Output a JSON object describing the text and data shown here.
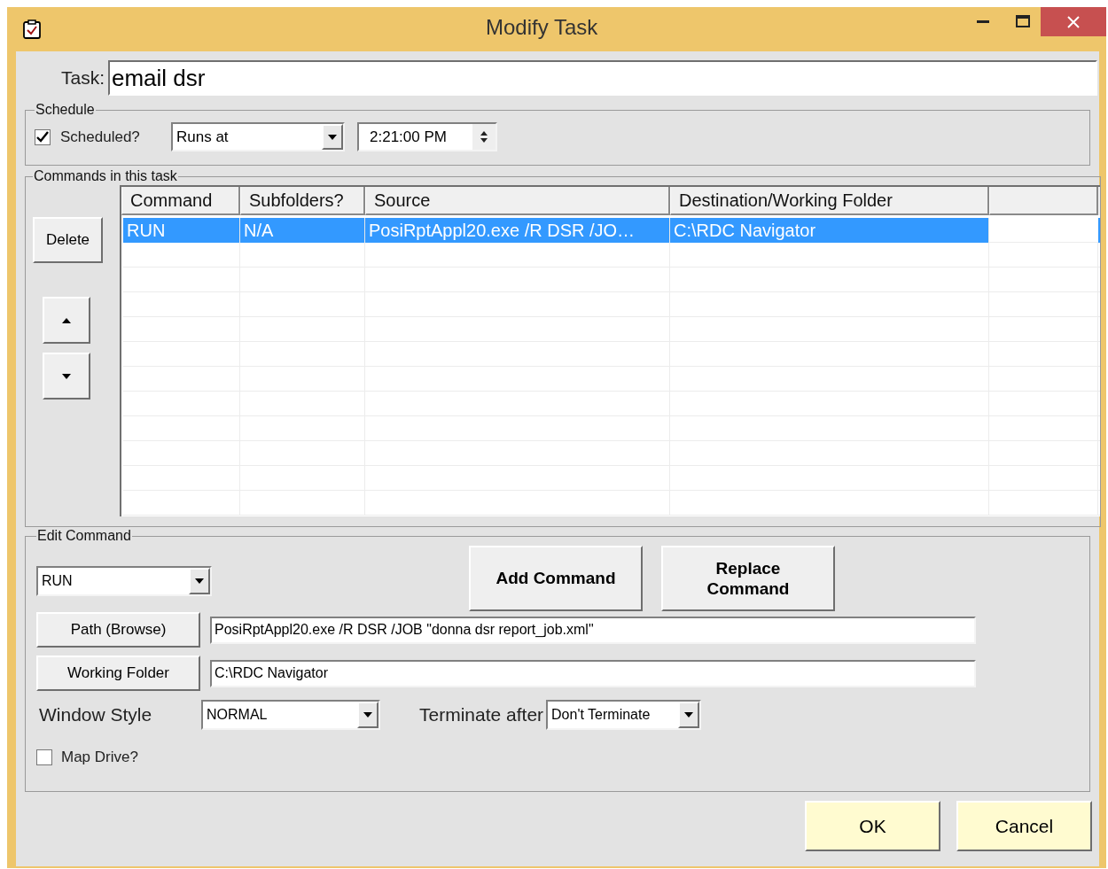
{
  "window": {
    "title": "Modify Task"
  },
  "task": {
    "label": "Task:",
    "value": "email dsr"
  },
  "schedule": {
    "legend": "Schedule",
    "scheduled": {
      "label": "Scheduled?",
      "checked": true
    },
    "mode": {
      "value": "Runs at"
    },
    "time": {
      "value": "2:21:00 PM"
    }
  },
  "commands": {
    "legend": "Commands in this task",
    "delete_button": "Delete",
    "table": {
      "columns": [
        "Command",
        "Subfolders?",
        "Source",
        "Destination/Working Folder"
      ],
      "rows": [
        {
          "cells": [
            "RUN",
            "N/A",
            "PosiRptAppl20.exe /R DSR /JO…",
            "C:\\RDC Navigator"
          ],
          "selected": true
        }
      ]
    }
  },
  "edit_command": {
    "legend": "Edit Command",
    "command_type": {
      "value": "RUN"
    },
    "add_button": "Add Command",
    "replace_button": "Replace Command",
    "path": {
      "button": "Path (Browse)",
      "value": "PosiRptAppl20.exe /R DSR /JOB \"donna dsr report_job.xml\""
    },
    "folder": {
      "button": "Working Folder",
      "value": "C:\\RDC Navigator"
    },
    "window_style": {
      "label": "Window Style",
      "value": "NORMAL"
    },
    "terminate": {
      "label": "Terminate after",
      "value": "Don't Terminate"
    },
    "map_drive": {
      "label": "Map Drive?",
      "checked": false
    }
  },
  "buttons": [
    "OK",
    "Cancel"
  ]
}
